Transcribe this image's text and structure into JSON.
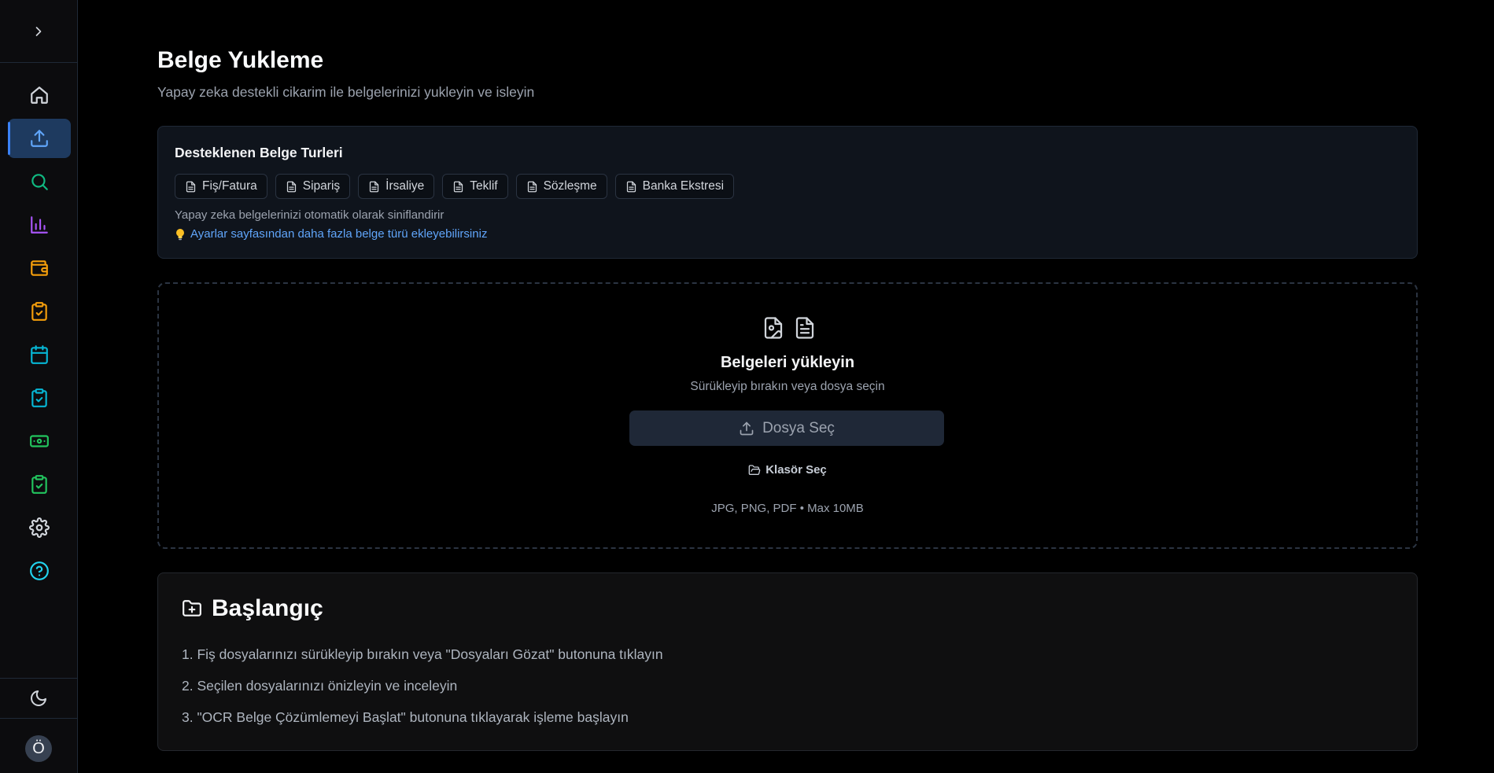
{
  "sidebar": {
    "items": [
      {
        "name": "home",
        "icon": "home-icon",
        "color": "#d1d5db"
      },
      {
        "name": "upload",
        "icon": "upload-icon",
        "color": "#60a5fa",
        "active": true
      },
      {
        "name": "search",
        "icon": "search-icon",
        "color": "#10b981"
      },
      {
        "name": "reports",
        "icon": "bar-chart-icon",
        "color": "#a855f7"
      },
      {
        "name": "wallet",
        "icon": "wallet-icon",
        "color": "#f59e0b"
      },
      {
        "name": "tasks",
        "icon": "clipboard-check-icon",
        "color": "#f59e0b"
      },
      {
        "name": "calendar",
        "icon": "calendar-icon",
        "color": "#06b6d4"
      },
      {
        "name": "checklist",
        "icon": "clipboard-check-icon",
        "color": "#06b6d4"
      },
      {
        "name": "payments",
        "icon": "banknote-icon",
        "color": "#22c55e"
      },
      {
        "name": "approvals",
        "icon": "clipboard-check-icon",
        "color": "#22c55e"
      },
      {
        "name": "settings",
        "icon": "gear-icon",
        "color": "#d1d5db"
      },
      {
        "name": "help",
        "icon": "help-circle-icon",
        "color": "#22d3ee"
      }
    ],
    "avatar_initial": "Ö"
  },
  "header": {
    "title": "Belge Yukleme",
    "subtitle": "Yapay zeka destekli cikarim ile belgelerinizi yukleyin ve isleyin"
  },
  "types": {
    "title": "Desteklenen Belge Turleri",
    "chips": [
      "Fiş/Fatura",
      "Sipariş",
      "İrsaliye",
      "Teklif",
      "Sözleşme",
      "Banka Ekstresi"
    ],
    "note": "Yapay zeka belgelerinizi otomatik olarak siniflandirir",
    "tip": "Ayarlar sayfasından daha fazla belge türü ekleyebilirsiniz"
  },
  "upload": {
    "title": "Belgeleri yükleyin",
    "subtitle": "Sürükleyip bırakın veya dosya seçin",
    "button_label": "Dosya Seç",
    "folder_label": "Klasör Seç",
    "formats": "JPG, PNG, PDF • Max 10MB"
  },
  "start": {
    "title": "Başlangıç",
    "steps": [
      "1. Fiş dosyalarınızı sürükleyip bırakın veya \"Dosyaları Gözat\" butonuna tıklayın",
      "2. Seçilen dosyalarınızı önizleyin ve inceleyin",
      "3. \"OCR Belge Çözümlemeyi Başlat\" butonuna tıklayarak işleme başlayın"
    ]
  }
}
